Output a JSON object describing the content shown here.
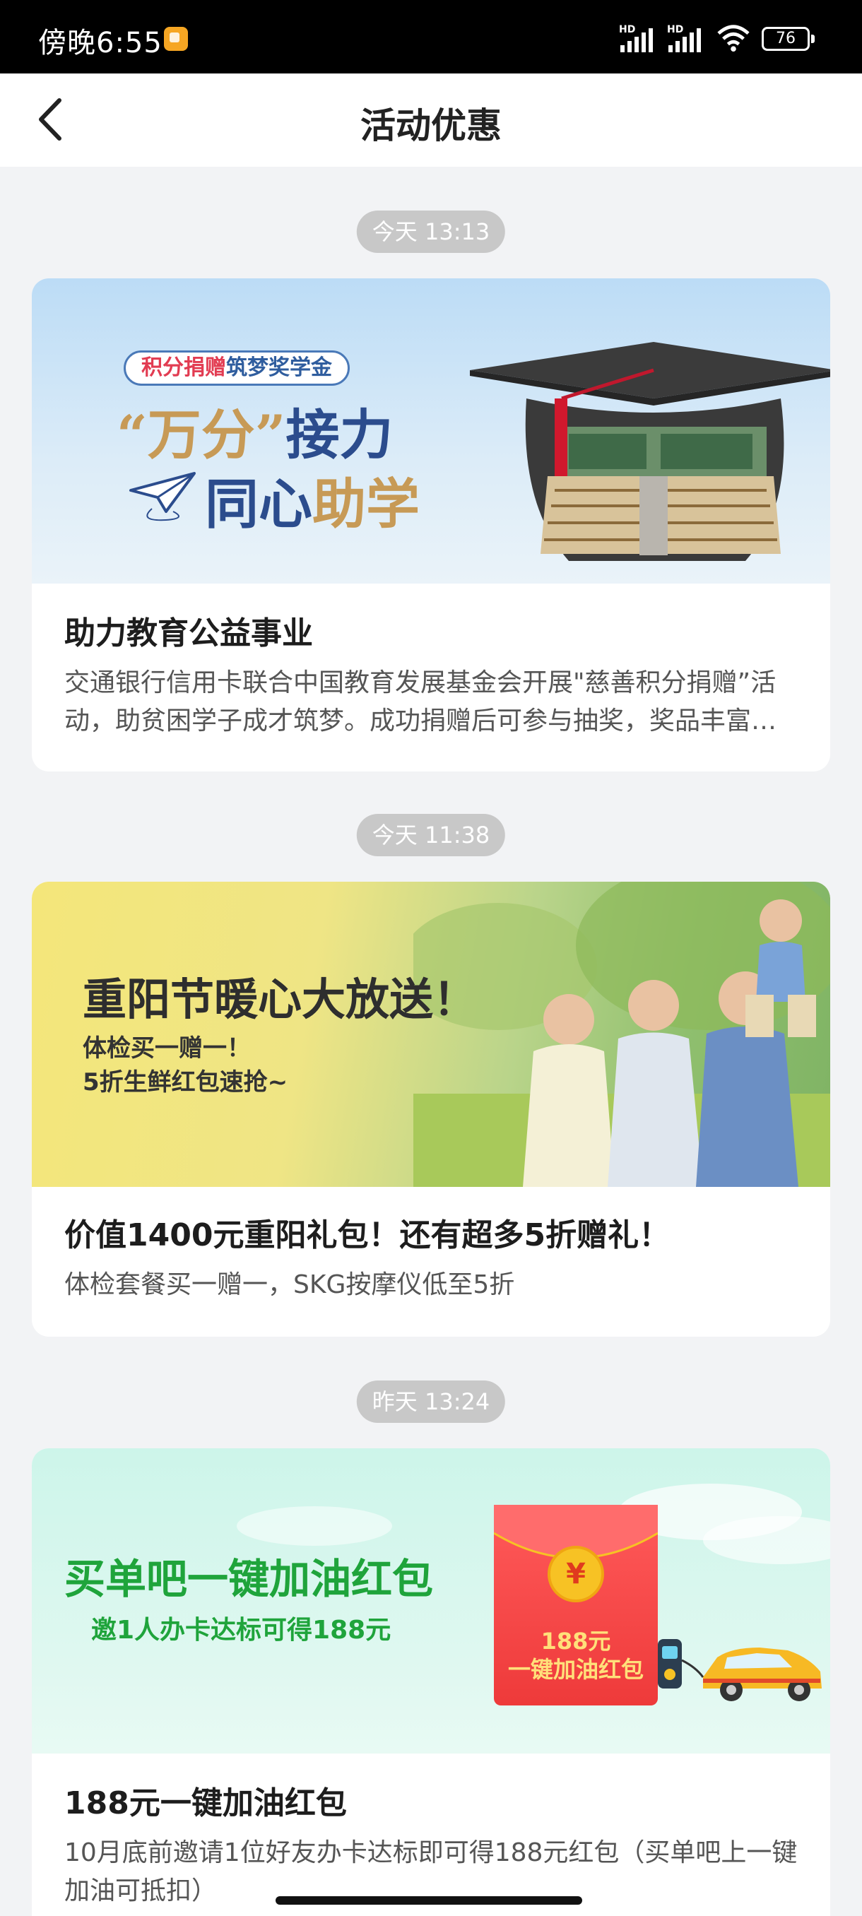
{
  "status_bar": {
    "time": "傍晚6:55",
    "battery": "76",
    "network_labels": [
      "HD",
      "HD"
    ]
  },
  "header": {
    "title": "活动优惠"
  },
  "feed": [
    {
      "timestamp": "今天 13:13",
      "banner": {
        "badge_red": "积分捐赠",
        "badge_blue": "筑梦奖学金",
        "line1_gold": "“万分”",
        "line1_blue": "接力",
        "line2_blue": "同心",
        "line2_gold": "助学"
      },
      "title": "助力教育公益事业",
      "description": "交通银行信用卡联合中国教育发展基金会开展\"慈善积分捐赠”活动，助贫困学子成才筑梦。成功捐赠后可参与抽奖，奖品丰富，快来参与吧！"
    },
    {
      "timestamp": "今天 11:38",
      "banner": {
        "title": "重阳节暖心大放送！",
        "sub1": "体检买一赠一！",
        "sub2": "5折生鲜红包速抢~"
      },
      "title": "价值1400元重阳礼包！还有超多5折赠礼！",
      "description": "体检套餐买一赠一，SKG按摩仪低至5折"
    },
    {
      "timestamp": "昨天 13:24",
      "banner": {
        "title": "买单吧一键加油红包",
        "sub": "邀1人办卡达标可得188元",
        "envelope_coin": "¥",
        "envelope_amount": "188元",
        "envelope_text": "一键加油红包"
      },
      "title": "188元一键加油红包",
      "description": "10月底前邀请1位好友办卡达标即可得188元红包（买单吧上一键加油可抵扣）"
    }
  ],
  "colors": {
    "page_bg": "#f2f3f5",
    "card_bg": "#ffffff",
    "timestamp_bg": "#c8c8c8",
    "green_accent": "#1fa43b",
    "red_envelope": "#ee3a3a"
  }
}
